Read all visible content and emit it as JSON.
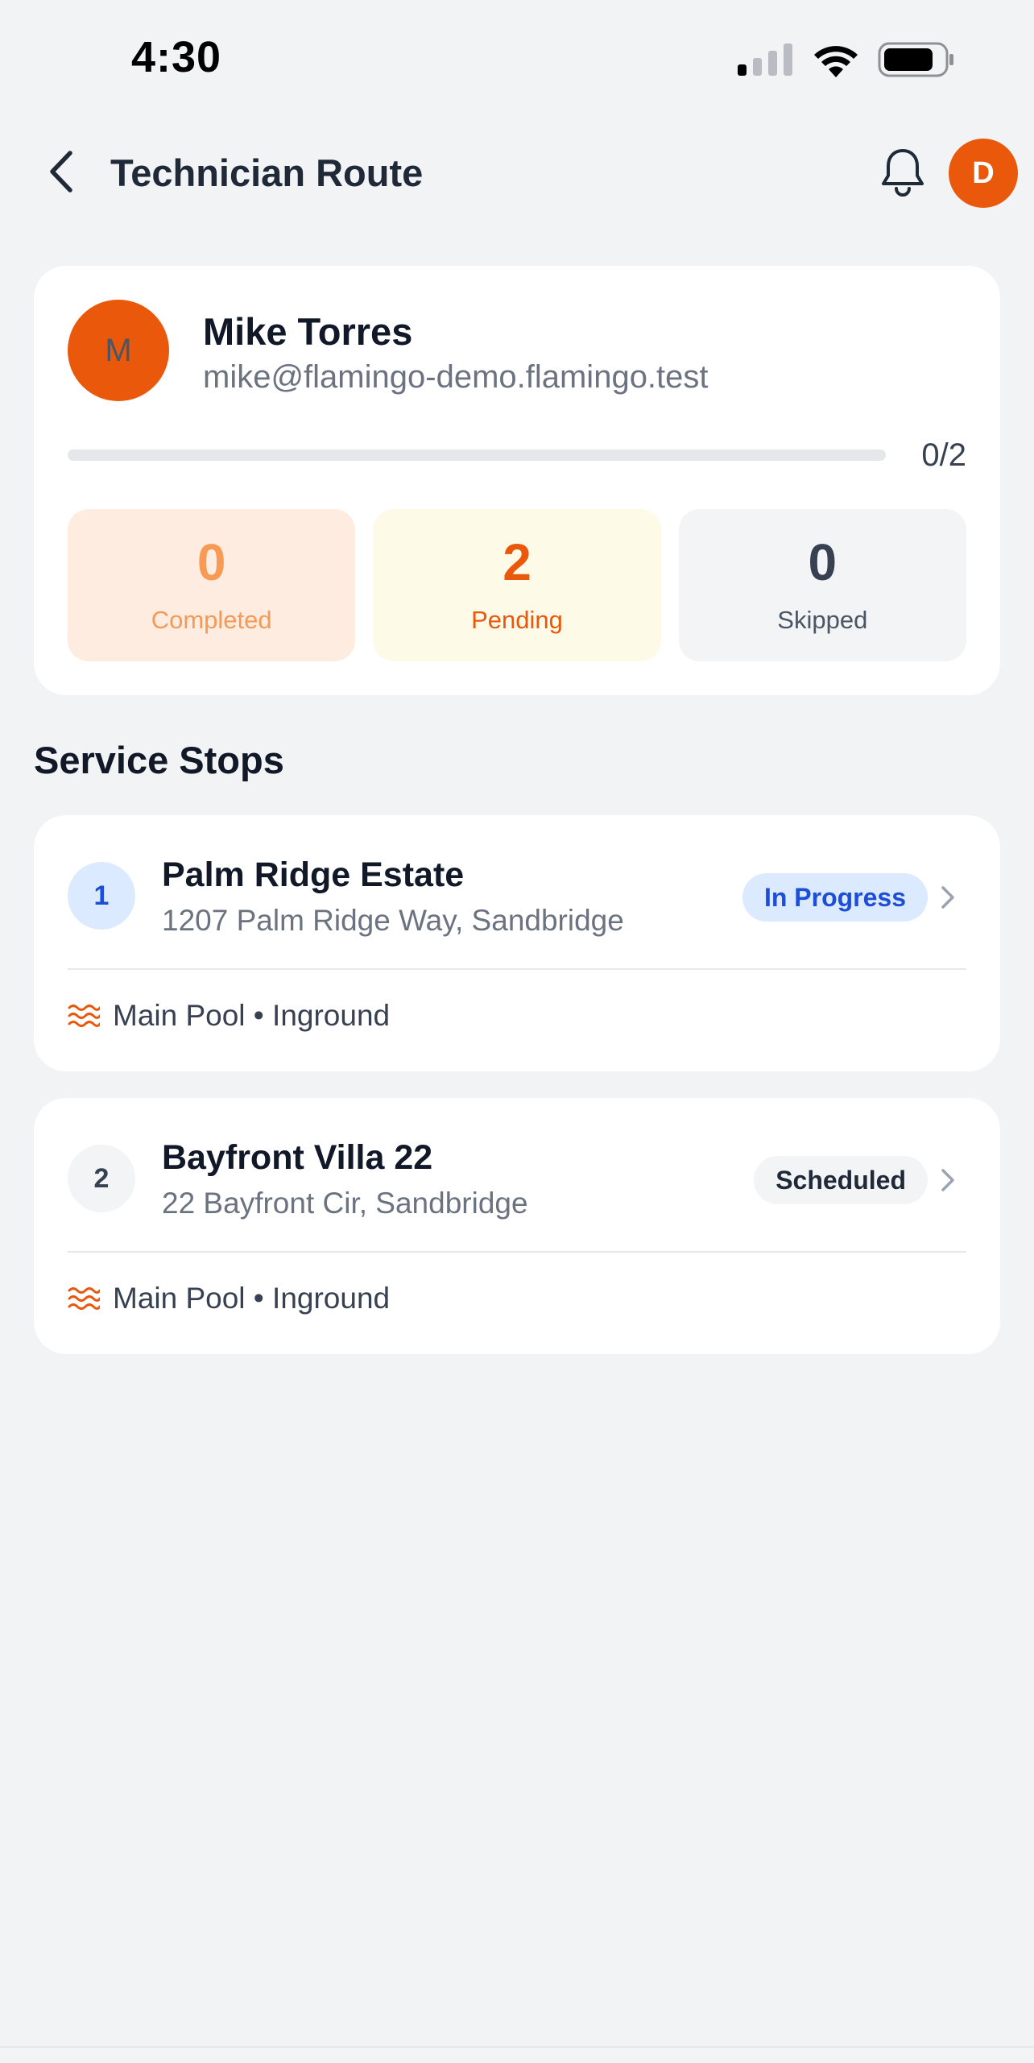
{
  "status_bar": {
    "time": "4:30",
    "icons": [
      "signal-icon",
      "wifi-icon",
      "battery-icon"
    ]
  },
  "header": {
    "title": "Technician Route",
    "back_icon": "chevron-left-icon",
    "bell_icon": "bell-icon",
    "avatar_initial": "D"
  },
  "technician": {
    "initial": "M",
    "name": "Mike Torres",
    "email": "mike@flamingo-demo.flamingo.test",
    "progress_label": "0/2",
    "progress_fraction": 0
  },
  "stats": {
    "completed": {
      "value": "0",
      "label": "Completed"
    },
    "pending": {
      "value": "2",
      "label": "Pending"
    },
    "skipped": {
      "value": "0",
      "label": "Skipped"
    }
  },
  "section_title": "Service Stops",
  "stops": [
    {
      "number": "1",
      "name": "Palm Ridge Estate",
      "address": "1207 Palm Ridge Way, Sandbridge",
      "status": "In Progress",
      "pool": "Main Pool • Inground"
    },
    {
      "number": "2",
      "name": "Bayfront Villa 22",
      "address": "22 Bayfront Cir, Sandbridge",
      "status": "Scheduled",
      "pool": "Main Pool • Inground"
    }
  ],
  "colors": {
    "accent": "#ea580c",
    "in_progress_bg": "#dbeafe",
    "in_progress_text": "#1d4ed8",
    "background": "#f2f3f5"
  }
}
